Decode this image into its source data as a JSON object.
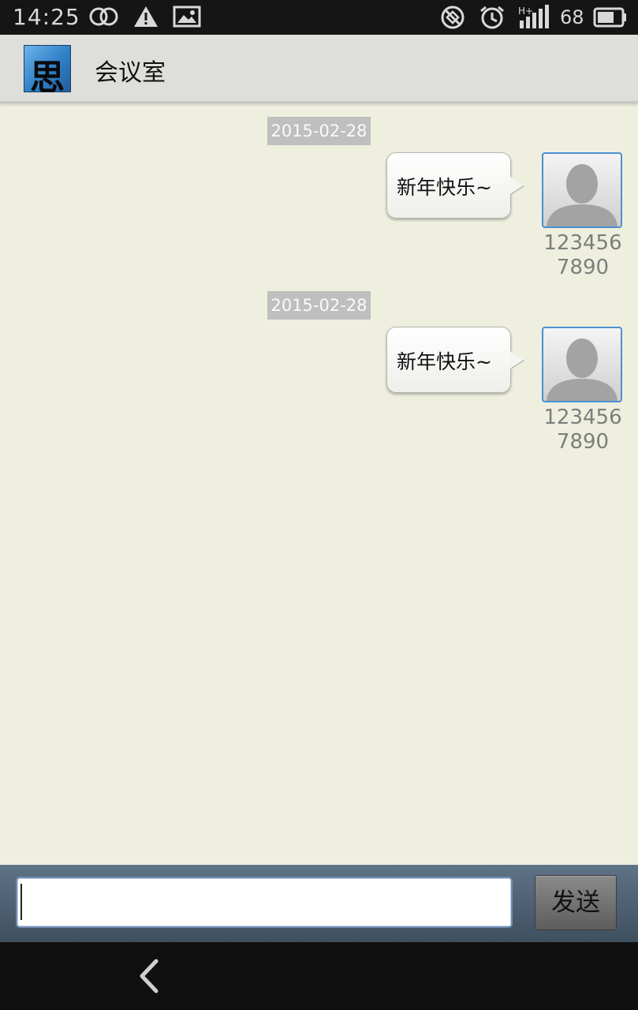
{
  "status_bar": {
    "time": "14:25",
    "battery_level": "68",
    "icons": [
      "dual-sim-icon",
      "warning-icon",
      "image-icon",
      "rotation-lock-icon",
      "alarm-icon",
      "signal-hplus-icon",
      "battery-icon"
    ]
  },
  "app_bar": {
    "logo_char": "思",
    "title": "会议室"
  },
  "messages": [
    {
      "date": "2015-02-28",
      "text": "新年快乐~",
      "sender_line1": "123456",
      "sender_line2": "7890"
    },
    {
      "date": "2015-02-28",
      "text": "新年快乐~",
      "sender_line1": "123456",
      "sender_line2": "7890"
    }
  ],
  "composer": {
    "input_value": "",
    "send_label": "发送"
  },
  "colors": {
    "background": "#efefdf",
    "status_bar": "#151515",
    "app_bar": "#dededb",
    "avatar_border": "#4a90d0",
    "input_bar": "#4f6173"
  }
}
